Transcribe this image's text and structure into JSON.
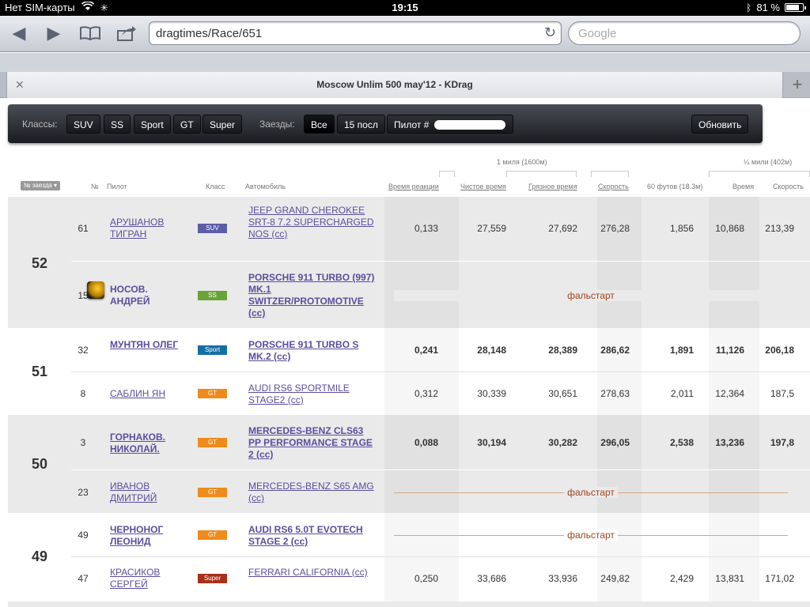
{
  "status": {
    "carrier": "Нет SIM-карты",
    "time": "19:15",
    "battery": "81 %",
    "battery_level": 0.81
  },
  "browser": {
    "url": "dragtimes/Race/651",
    "search_placeholder": "Google",
    "tab_title": "Moscow Unlim 500 may'12 - KDrag"
  },
  "filters": {
    "classes_label": "Классы:",
    "classes": [
      "SUV",
      "SS",
      "Sport",
      "GT",
      "Super"
    ],
    "runs_label": "Заезды:",
    "runs": [
      "Все",
      "15 посл"
    ],
    "pilot_label": "Пилот #",
    "refresh": "Обновить"
  },
  "table": {
    "group_mile": "1 миля (1600м)",
    "group_quarter": "¼ мили (402м)",
    "columns": {
      "race_no": "№ заезда",
      "no": "№",
      "pilot": "Пилот",
      "class": "Класс",
      "car": "Автомобиль",
      "reaction": "Время реакции",
      "clean": "Чистое время",
      "dirty": "Грязное время",
      "speed": "Скорость",
      "ft60": "60 футов (18.3м)",
      "time": "Время",
      "speed2": "Скорость"
    },
    "false_start": "фальстарт",
    "groups": [
      {
        "num": "52",
        "rows": [
          {
            "no": "61",
            "pilot": "АРУШАНОВ ТИГРАН",
            "cls": "SUV",
            "car": "JEEP GRAND CHEROKEE SRT-8 7.2 SUPERCHARGED NOS (cc)",
            "reaction": "0,133",
            "clean": "27,559",
            "dirty": "27,692",
            "speed": "276,28",
            "ft60": "1,856",
            "time": "10,868",
            "speed2": "213,39"
          },
          {
            "no": "15",
            "pilot": "НОСОВ. АНДРЕЙ",
            "cls": "SS",
            "car": "PORSCHE 911 TURBO (997) MK.1 SWITZER/PROTOMOTIVE (cc)"
          }
        ]
      },
      {
        "num": "51",
        "rows": [
          {
            "no": "32",
            "pilot": "МУНТЯН ОЛЕГ",
            "cls": "Sport",
            "car": "PORSCHE 911 TURBO S MK.2 (cc)",
            "reaction": "0,241",
            "clean": "28,148",
            "dirty": "28,389",
            "speed": "286,62",
            "ft60": "1,891",
            "time": "11,126",
            "speed2": "206,18"
          },
          {
            "no": "8",
            "pilot": "САБЛИН ЯН",
            "cls": "GT",
            "car": "AUDI RS6 SPORTMILE STAGE2 (cc)",
            "reaction": "0,312",
            "clean": "30,339",
            "dirty": "30,651",
            "speed": "278,63",
            "ft60": "2,011",
            "time": "12,364",
            "speed2": "187,5"
          }
        ]
      },
      {
        "num": "50",
        "rows": [
          {
            "no": "3",
            "pilot": "ГОРНАКОВ. НИКОЛАЙ.",
            "cls": "GT",
            "car": "MERCEDES-BENZ CLS63 PP PERFORMANCE STAGE 2 (cc)",
            "reaction": "0,088",
            "clean": "30,194",
            "dirty": "30,282",
            "speed": "296,05",
            "ft60": "2,538",
            "time": "13,236",
            "speed2": "197,8"
          },
          {
            "no": "23",
            "pilot": "ИВАНОВ ДМИТРИЙ",
            "cls": "GT",
            "car": "MERCEDES-BENZ S65 AMG (cc)"
          }
        ]
      },
      {
        "num": "49",
        "rows": [
          {
            "no": "49",
            "pilot": "ЧЕРНОНОГ ЛЕОНИД",
            "cls": "GT",
            "car": "AUDI RS6 5.0T EVOTECH STAGE 2 (cc)"
          },
          {
            "no": "47",
            "pilot": "КРАСИКОВ СЕРГЕЙ",
            "cls": "Super",
            "car": "FERRARI CALIFORNIA (cc)",
            "reaction": "0,250",
            "clean": "33,686",
            "dirty": "33,936",
            "speed": "249,82",
            "ft60": "2,429",
            "time": "13,831",
            "speed2": "171,02"
          }
        ]
      }
    ]
  },
  "class_colors": {
    "SUV": "#5b5ea6",
    "SS": "#6aa338",
    "Sport": "#146fa3",
    "GT": "#ef8b1c",
    "Super": "#a8301a"
  }
}
